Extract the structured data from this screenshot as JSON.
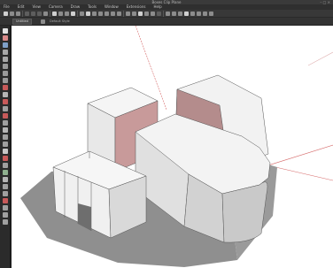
{
  "window": {
    "title": "Boxes Clip Plane",
    "controls": "– □ ×"
  },
  "menubar": {
    "items": [
      "File",
      "Edit",
      "View",
      "Camera",
      "Draw",
      "Tools",
      "Window",
      "Extensions",
      "Help"
    ]
  },
  "toolbar": {
    "tab_label": "Untitled",
    "style_label": "Default Style"
  },
  "colors": {
    "viewport_bg": "#ffffff",
    "model_face_white": "#f4f4f4",
    "model_face_shade": "#c9c9c9",
    "model_face_back": "#b48c8c",
    "axis_red": "#d66a6a",
    "shadow": "#8f8f8f",
    "ui_dark": "#2f2f2f"
  },
  "icons": {
    "left_toolbar": [
      "select-icon",
      "eraser-icon",
      "paint-bucket-icon",
      "line-icon",
      "arc-icon",
      "rectangle-icon",
      "circle-icon",
      "polygon-icon",
      "move-icon",
      "push-pull-icon",
      "rotate-icon",
      "follow-me-icon",
      "scale-icon",
      "offset-icon",
      "tape-measure-icon",
      "dimension-icon",
      "protractor-icon",
      "text-icon",
      "axes-icon",
      "3d-text-icon",
      "orbit-icon",
      "pan-icon",
      "zoom-icon",
      "zoom-window-icon",
      "zoom-extents-icon",
      "walk-icon",
      "look-around-icon",
      "section-plane-icon"
    ],
    "top_toolbar": [
      "new-icon",
      "open-icon",
      "save-icon",
      "cut-icon",
      "copy-icon",
      "paste-icon",
      "erase-icon",
      "undo-icon",
      "redo-icon",
      "print-icon",
      "model-info-icon",
      "camera-icon",
      "iso-view-icon",
      "top-view-icon",
      "front-view-icon",
      "right-view-icon",
      "back-view-icon",
      "left-view-icon",
      "xray-icon",
      "wireframe-icon",
      "hidden-line-icon",
      "shaded-icon",
      "shaded-texture-icon",
      "monochrome-icon",
      "shadows-icon",
      "fog-icon",
      "section-cuts-icon",
      "components-icon",
      "materials-icon",
      "styles-icon",
      "layers-icon",
      "scenes-icon"
    ]
  }
}
